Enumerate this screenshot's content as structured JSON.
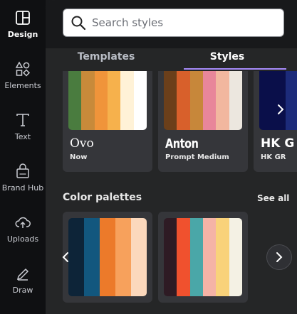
{
  "rail": {
    "items": [
      {
        "label": "Design",
        "icon": "layout-icon",
        "active": true
      },
      {
        "label": "Elements",
        "icon": "shapes-icon",
        "active": false
      },
      {
        "label": "Text",
        "icon": "text-icon",
        "active": false
      },
      {
        "label": "Brand Hub",
        "icon": "brand-bag-icon",
        "active": false
      },
      {
        "label": "Uploads",
        "icon": "cloud-upload-icon",
        "active": false
      },
      {
        "label": "Draw",
        "icon": "pen-icon",
        "active": false
      }
    ]
  },
  "search": {
    "placeholder": "Search styles",
    "value": ""
  },
  "tabs": [
    {
      "label": "Templates",
      "selected": false
    },
    {
      "label": "Styles",
      "selected": true
    }
  ],
  "style_cards": [
    {
      "font": "Ovo",
      "sub": "Now",
      "colors": [
        "#4a7c3f",
        "#c88a3a",
        "#f0943a",
        "#f6b14c",
        "#fff2d7",
        "#ffffff"
      ]
    },
    {
      "font": "Anton",
      "sub": "Prompt Medium",
      "colors": [
        "#6b3f1a",
        "#d8602b",
        "#c7873a",
        "#e8869a",
        "#f2b79f",
        "#ece7df"
      ]
    },
    {
      "font": "HK G",
      "sub": "HK GR",
      "colors": [
        "#0a0f4a",
        "#1c2b7a",
        "#3547a6"
      ]
    }
  ],
  "color_palettes": {
    "title": "Color palettes",
    "see_all": "See all",
    "items": [
      {
        "colors": [
          "#0d2438",
          "#12577e",
          "#ec7a2a",
          "#f7a15c",
          "#fbd8bc"
        ]
      },
      {
        "colors": [
          "#2e1b24",
          "#f0512e",
          "#4aa7a8",
          "#f5b3a6",
          "#f9d27a",
          "#f4f1e4"
        ]
      }
    ]
  },
  "accent": "#a78bfa"
}
